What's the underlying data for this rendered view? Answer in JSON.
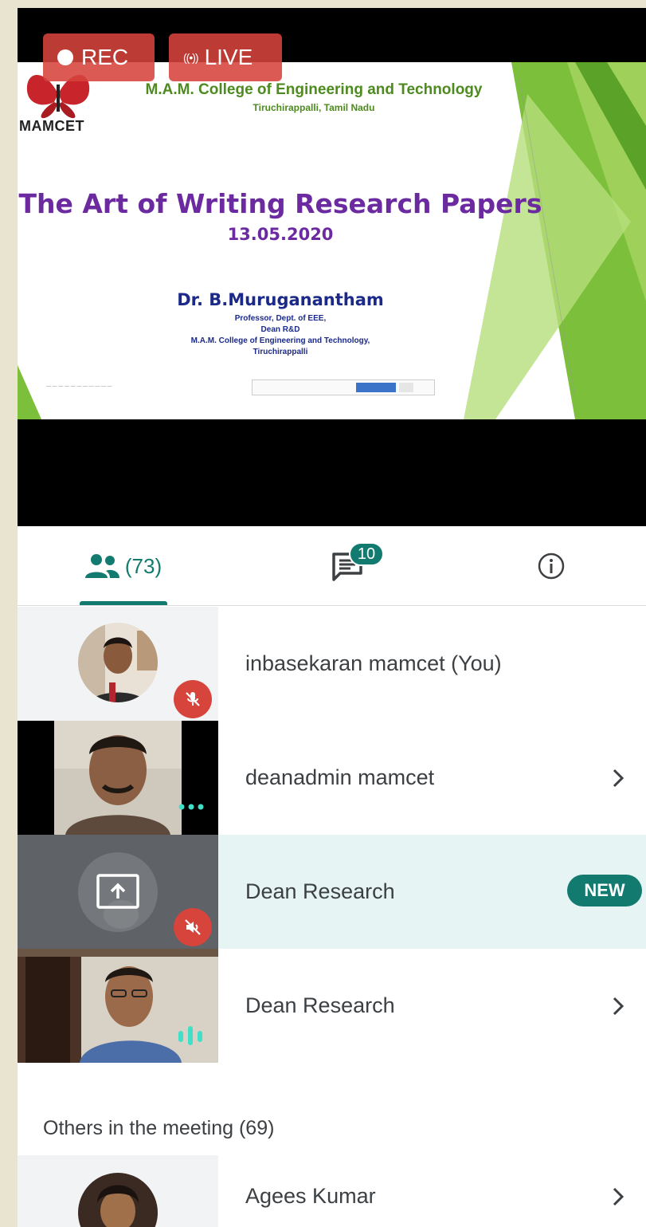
{
  "recording": {
    "rec_label": "REC",
    "live_label": "LIVE",
    "live_icon": "((•))"
  },
  "slide": {
    "logo_text": "MAMCET",
    "college_name": "M.A.M. College of Engineering and Technology",
    "college_place": "Tiruchirappalli, Tamil Nadu",
    "title": "The Art of Writing Research Papers",
    "date": "13.05.2020",
    "speaker": "Dr. B.Muruganantham",
    "speaker_lines": [
      "Professor, Dept. of EEE,",
      "Dean R&D",
      "M.A.M. College of Engineering and Technology,",
      "Tiruchirappalli"
    ]
  },
  "tabs": {
    "people_count": "(73)",
    "chat_badge": "10",
    "people_icon": "people-icon",
    "chat_icon": "chat-icon",
    "info_icon": "info-icon"
  },
  "participants": [
    {
      "name": "inbasekaran mamcet (You)",
      "muted": true,
      "chevron": false
    },
    {
      "name": "deanadmin mamcet",
      "muted": false,
      "chevron": true
    },
    {
      "name": "Dean Research",
      "muted": true,
      "chevron": false,
      "badge": "NEW",
      "presenting": true
    },
    {
      "name": "Dean Research",
      "muted": false,
      "chevron": true,
      "speaking": true
    }
  ],
  "others": {
    "label": "Others in the meeting (69)",
    "first_name": "Agees Kumar"
  },
  "colors": {
    "accent": "#127a6e",
    "rec": "#d6443b",
    "highlight_row": "#e6f4f3"
  }
}
